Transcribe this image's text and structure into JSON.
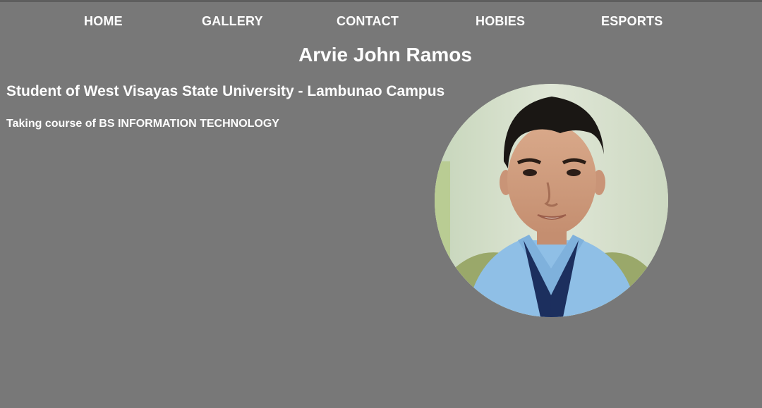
{
  "nav": {
    "items": [
      {
        "label": "HOME"
      },
      {
        "label": "GALLERY"
      },
      {
        "label": "CONTACT"
      },
      {
        "label": "HOBIES"
      },
      {
        "label": "ESPORTS"
      }
    ]
  },
  "profile": {
    "name": "Arvie John Ramos",
    "subtitle": "Student of West Visayas State University - Lambunao Campus",
    "course": "Taking course of BS INFORMATION TECHNOLOGY",
    "photo_icon": "profile-photo"
  },
  "colors": {
    "background": "#787878",
    "text": "#ffffff"
  }
}
